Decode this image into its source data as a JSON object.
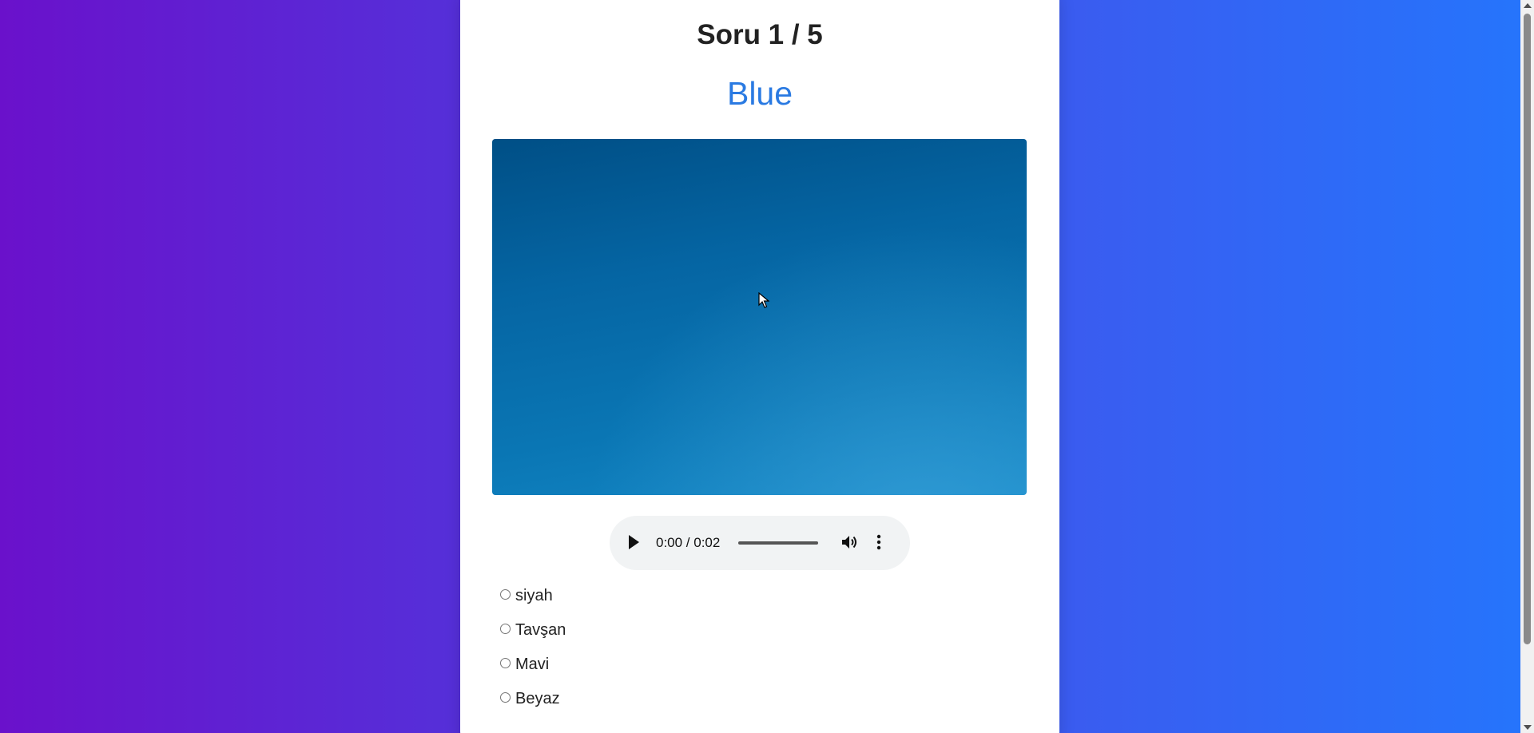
{
  "quiz": {
    "title": "Soru 1 / 5",
    "word": "Blue",
    "word_color": "#2a7ae2",
    "image": {
      "description_icon": "sky-image"
    },
    "audio": {
      "time": "0:00 / 0:02",
      "play_icon": "play-icon",
      "volume_icon": "volume-icon",
      "more_icon": "more-vert-icon"
    },
    "options": [
      {
        "label": "siyah"
      },
      {
        "label": "Tavşan"
      },
      {
        "label": "Mavi"
      },
      {
        "label": "Beyaz"
      }
    ]
  },
  "theme": {
    "gradient_start": "#6a11cb",
    "gradient_end": "#2575fc",
    "card_bg": "#ffffff"
  }
}
